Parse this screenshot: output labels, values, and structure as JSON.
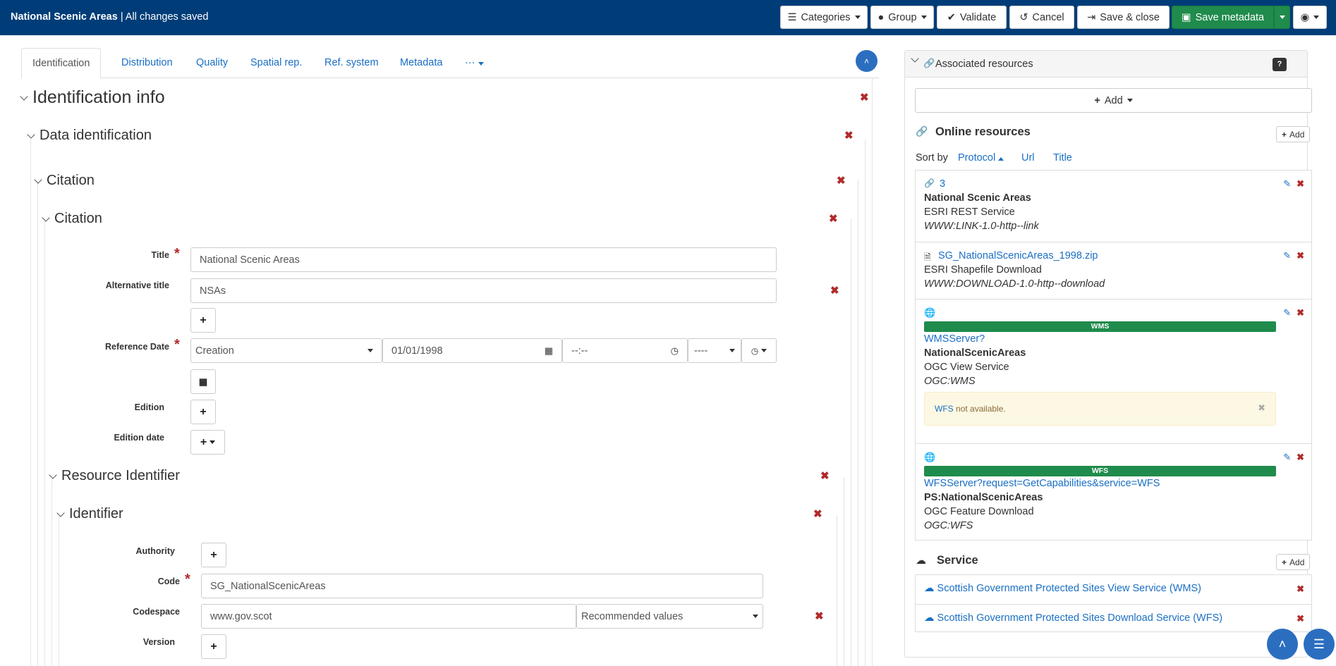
{
  "header": {
    "app_title": "National Scenic Areas",
    "save_status": "| All changes saved",
    "buttons": {
      "categories": "Categories",
      "group": "Group",
      "validate": "Validate",
      "cancel": "Cancel",
      "save_close": "Save & close",
      "save_metadata": "Save metadata"
    }
  },
  "tabs": [
    {
      "label": "Identification",
      "active": true
    },
    {
      "label": "Distribution"
    },
    {
      "label": "Quality"
    },
    {
      "label": "Spatial rep."
    },
    {
      "label": "Ref. system"
    },
    {
      "label": "Metadata"
    },
    {
      "label": "···"
    }
  ],
  "form": {
    "identification_info": "Identification info",
    "data_identification": "Data identification",
    "citation_outer": "Citation",
    "citation_inner": "Citation",
    "title_label": "Title",
    "title_value": "National Scenic Areas",
    "alt_title_label": "Alternative title",
    "alt_title_value": "NSAs",
    "ref_date_label": "Reference Date",
    "ref_date_type": "Creation",
    "ref_date_value": "01/01/1998",
    "ref_time_value": "--:--",
    "ref_tz_value": "----",
    "edition_label": "Edition",
    "edition_date_label": "Edition date",
    "resource_identifier": "Resource Identifier",
    "identifier": "Identifier",
    "authority_label": "Authority",
    "code_label": "Code",
    "code_value": "SG_NationalScenicAreas",
    "codespace_label": "Codespace",
    "codespace_value": "www.gov.scot",
    "codespace_select": "Recommended values",
    "version_label": "Version"
  },
  "sidebar": {
    "title": "Associated resources",
    "add_label": "Add",
    "online_resources_title": "Online resources",
    "add_small": "Add",
    "sort_by": "Sort by",
    "sort_options": [
      "Protocol",
      "Url",
      "Title"
    ],
    "resources": [
      {
        "link": "3",
        "name": "National Scenic Areas",
        "desc": "ESRI REST Service",
        "protocol": "WWW:LINK-1.0-http--link"
      },
      {
        "link": "SG_NationalScenicAreas_1998.zip",
        "desc": "ESRI Shapefile Download",
        "protocol": "WWW:DOWNLOAD-1.0-http--download"
      },
      {
        "badge": "WMS",
        "link": "WMSServer?",
        "name": "NationalScenicAreas",
        "desc": "OGC View Service",
        "protocol": "OGC:WMS",
        "alert_link": "WFS",
        "alert_text": "not available."
      },
      {
        "badge": "WFS",
        "link": "WFSServer?request=GetCapabilities&service=WFS",
        "name": "PS:NationalScenicAreas",
        "desc": "OGC Feature Download",
        "protocol": "OGC:WFS"
      }
    ],
    "service_title": "Service",
    "service_add": "Add",
    "services": [
      "Scottish Government Protected Sites View Service (WMS)",
      "Scottish Government Protected Sites Download Service (WFS)"
    ]
  },
  "colors": {
    "header_bg": "#003d78",
    "accent": "#1a6fc4",
    "success": "#1f8b4c",
    "danger": "#b12a2a"
  }
}
